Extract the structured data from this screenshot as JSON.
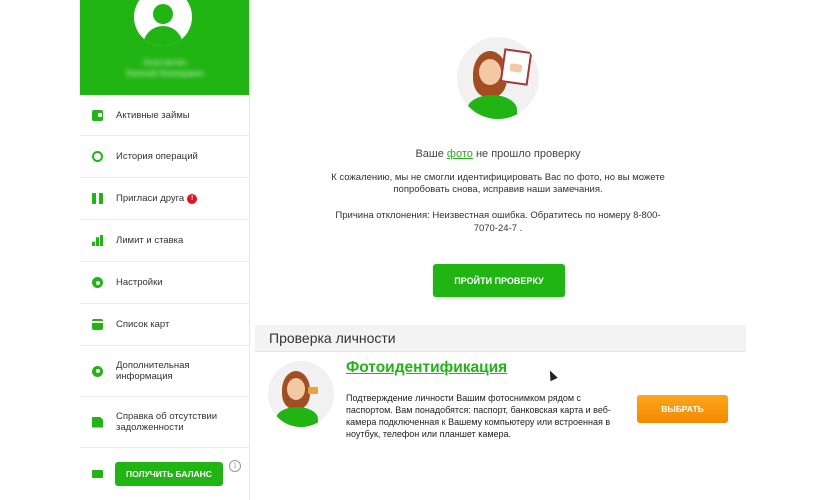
{
  "sidebar": {
    "profile": {
      "name_line1": "Константин",
      "name_line2": "Евгений Леонидович"
    },
    "items": [
      {
        "label": "Активные займы",
        "icon": "wallet-icon"
      },
      {
        "label": "История операций",
        "icon": "clock-icon"
      },
      {
        "label": "Пригласи друга",
        "icon": "gift-icon",
        "badge": "!"
      },
      {
        "label": "Лимит и ставка",
        "icon": "bar-chart-icon"
      },
      {
        "label": "Настройки",
        "icon": "gear-icon"
      },
      {
        "label": "Список карт",
        "icon": "card-icon"
      },
      {
        "label": "Дополнительная информация",
        "icon": "gear-icon"
      },
      {
        "label": "Справка об отсутствии задолженности",
        "icon": "document-icon"
      }
    ],
    "balance_button": "ПОЛУЧИТЬ БАЛАНС",
    "info_glyph": "i"
  },
  "main": {
    "status": {
      "title_before": "Ваше",
      "title_link": "фото",
      "title_after": "не прошло проверку",
      "message": "К сожалению, мы не смогли идентифицировать Вас по фото, но вы можете попробовать снова, исправив наши замечания.",
      "reason": "Причина отклонения: Неизвестная ошибка. Обратитесь по номеру 8-800-7070-24-7 ."
    },
    "verify_button": "ПРОЙТИ ПРОВЕРКУ",
    "section_title": "Проверка личности",
    "option": {
      "title": "Фотоидентификация",
      "description": "Подтверждение личности Вашим фотоснимком рядом с паспортом. Вам понадобятся: паспорт, банковская карта и веб-камера подключенная к Вашему компьютеру или встроенная в ноутбук, телефон или планшет камера.",
      "button": "ВЫБРАТЬ"
    }
  },
  "colors": {
    "brand_green": "#21b514",
    "accent_orange": "#f5960a",
    "badge_red": "#e2141e"
  }
}
